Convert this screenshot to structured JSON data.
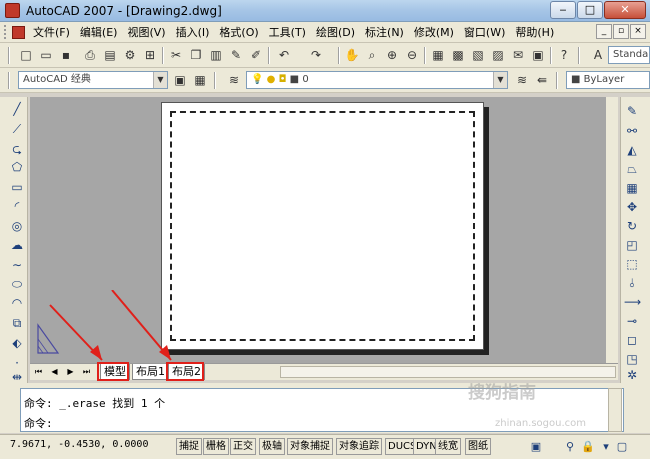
{
  "window": {
    "title": "AutoCAD 2007 - [Drawing2.dwg]",
    "min": "‒",
    "max": "□",
    "close": "✕"
  },
  "menubar": {
    "items": [
      "文件(F)",
      "编辑(E)",
      "视图(V)",
      "插入(I)",
      "格式(O)",
      "工具(T)",
      "绘图(D)",
      "标注(N)",
      "修改(M)",
      "窗口(W)",
      "帮助(H)"
    ],
    "doc_controls": [
      "_",
      "▫",
      "×"
    ]
  },
  "toolbar": {
    "text_style": "Standa",
    "workspace": "AutoCAD 经典",
    "layer": "0",
    "linetype": "ByLayer"
  },
  "layout": {
    "tabs": [
      "模型",
      "布局1",
      "布局2"
    ],
    "nav": [
      "⏮",
      "◀",
      "▶",
      "⏭"
    ]
  },
  "command": {
    "lines": [
      "命令: _.erase 找到 1 个",
      "命令:"
    ]
  },
  "status": {
    "coordinates": "7.9671, -0.4530, 0.0000",
    "buttons": [
      "捕捉",
      "栅格",
      "正交",
      "极轴",
      "对象捕捉",
      "对象追踪",
      "DUCS",
      "DYN",
      "线宽",
      "图纸"
    ]
  },
  "watermark": {
    "text": "搜狗指南",
    "url": "zhinan.sogou.com"
  }
}
